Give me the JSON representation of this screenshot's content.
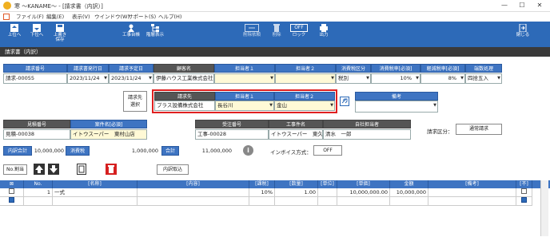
{
  "window": {
    "title": "寒 ～KANAME～ - [請求書（内訳）]",
    "min": "—",
    "max": "☐",
    "close": "✕"
  },
  "menu": [
    "ファイル(F)",
    "編集(E)",
    "表示(V)",
    "ウインドウ(W)",
    "サポート(S)",
    "ヘルプ(H)"
  ],
  "toolbar": {
    "prev": "上位へ",
    "next": "下位へ",
    "overwrite": "上書き\n保存",
    "ledger": "工事台帳",
    "hierarchy": "階層表示",
    "delete_request": "削除依頼",
    "delete": "削除",
    "lock": "ロック",
    "lock_state": "OFF",
    "output": "出力",
    "close": "閉じる"
  },
  "section_title": "請求書（内訳）",
  "header": {
    "cols": [
      "請求番号",
      "請求書発行日",
      "請求予定日",
      "顧客名",
      "担当者１",
      "担当者２",
      "消費税区分",
      "消費税率[必須]",
      "軽減税率[必須]",
      "端数処理"
    ],
    "values": {
      "invoice_no": "請求-00055",
      "issue_date": "2023/11/24",
      "planned_date": "2023/11/24",
      "customer": "伊藤ハウス工業株式会社",
      "staff1": "",
      "staff2": "",
      "tax_type": "税別",
      "tax_rate": "10%",
      "reduced_rate": "8%",
      "rounding": "四捨五入"
    }
  },
  "billing": {
    "select_btn": "請求先\n選択",
    "cols": [
      "請求先",
      "担当者１",
      "担当者２"
    ],
    "values": {
      "to": "プラス設備株式会社",
      "staff1": "長谷川",
      "staff2": "金山"
    },
    "remarks_label": "備考",
    "remarks": ""
  },
  "project": {
    "cols": [
      "見積番号",
      "案件名[必須]",
      "受注番号",
      "工事件名",
      "自社担当者"
    ],
    "values": {
      "estimate_no": "見積-00038",
      "case_name": "イトウスーパー　東村山店",
      "order_no": "工事-00028",
      "work_name": "イトウスーパー　東久留米店",
      "our_staff": "清水　一郎"
    },
    "billing_type_label": "請求区分：",
    "billing_type": "通常請求"
  },
  "totals": {
    "subtotal_label": "内訳合計",
    "subtotal": "10,000,000",
    "tax_label": "消費税",
    "tax": "1,000,000",
    "total_label": "合計",
    "total": "11,000,000",
    "invoice_label": "インボイス方式：",
    "invoice_state": "OFF"
  },
  "actions": {
    "renumber": "No.割当",
    "import": "内訳取込"
  },
  "grid": {
    "cols": [
      "No.",
      "[名称]",
      "[内容]",
      "[課税]",
      "[数量]",
      "[単位]",
      "[単価]",
      "金額",
      "[備考]",
      "[不]"
    ],
    "rows": [
      {
        "no": "1",
        "name": "一式",
        "content": "",
        "tax": "10%",
        "qty": "1.00",
        "unit": "",
        "price": "10,000,000.00",
        "amount": "10,000,000",
        "note": ""
      }
    ]
  }
}
